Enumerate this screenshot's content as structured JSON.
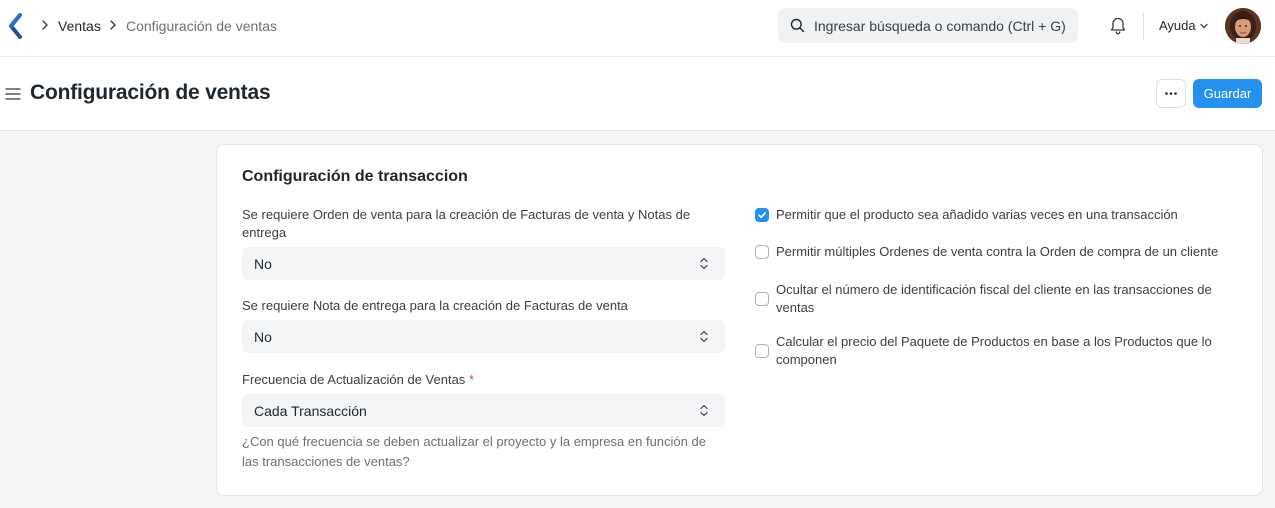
{
  "navbar": {
    "breadcrumbs": [
      "Ventas",
      "Configuración de ventas"
    ],
    "search_placeholder": "Ingresar búsqueda o comando (Ctrl + G)",
    "help_label": "Ayuda",
    "icons": [
      "app-logo-icon",
      "chevron-right-icon",
      "search-icon",
      "bell-icon",
      "chevron-down-icon",
      "avatar"
    ]
  },
  "page": {
    "title": "Configuración de ventas",
    "more_label": "···",
    "save_label": "Guardar"
  },
  "section": {
    "title": "Configuración de transaccion",
    "fields": [
      {
        "label": "Se requiere Orden de venta para la creación de Facturas de venta y Notas de entrega",
        "value": "No"
      },
      {
        "label": "Se requiere Nota de entrega para la creación de Facturas de venta",
        "value": "No"
      },
      {
        "label": "Frecuencia de Actualización de Ventas",
        "required_mark": "*",
        "value": "Cada Transacción",
        "description": "¿Con qué frecuencia se deben actualizar el proyecto y la empresa en función de las transacciones de ventas?"
      }
    ],
    "checkboxes": [
      {
        "label": "Permitir que el producto sea añadido varias veces en una transacción",
        "checked": true
      },
      {
        "label": "Permitir múltiples Ordenes de venta contra la Orden de compra de un cliente",
        "checked": false
      },
      {
        "label": "Ocultar el número de identificación fiscal del cliente en las transacciones de ventas",
        "checked": false
      },
      {
        "label": "Calcular el precio del Paquete de Productos en base a los Productos que lo componen",
        "checked": false
      }
    ]
  },
  "colors": {
    "primary": "#2490ef",
    "text": "#1f272e",
    "muted": "#687178",
    "required": "#e24c4c",
    "page_bg": "#f4f5f6"
  }
}
